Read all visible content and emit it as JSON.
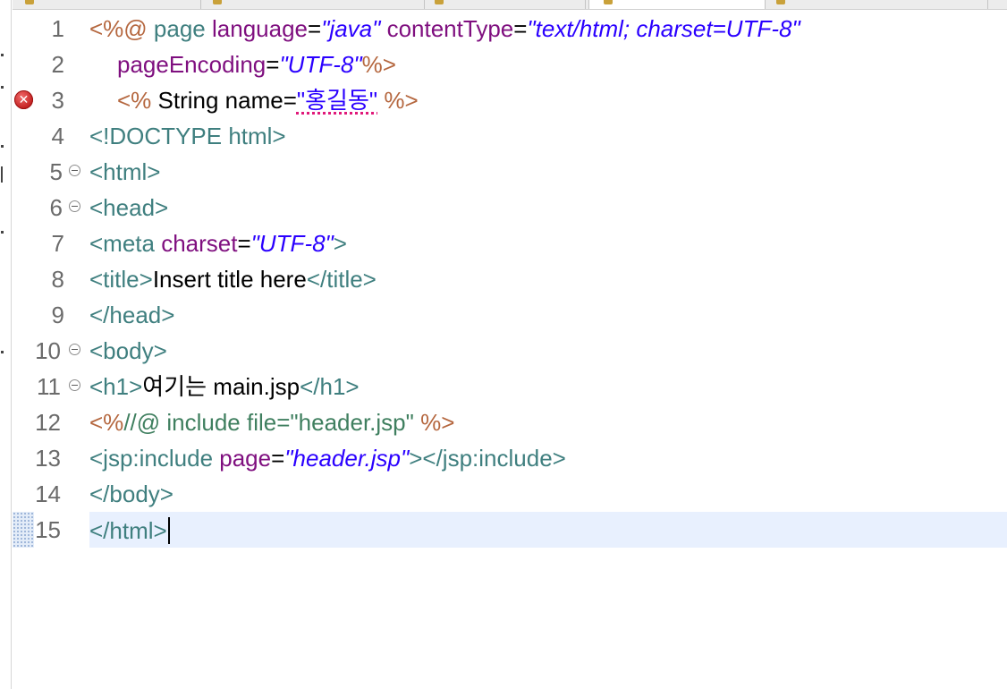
{
  "editor": {
    "lines": [
      {
        "number": "1",
        "tokens": [
          "<%@ ",
          "page ",
          "language",
          "=",
          "\"java\"",
          " ",
          "contentType",
          "=",
          "\"text/html; charset=UTF-8\""
        ]
      },
      {
        "number": "2",
        "tokens": [
          "pageEncoding",
          "=",
          "\"UTF-8\"",
          "%>"
        ]
      },
      {
        "number": "3",
        "tokens": [
          "<% ",
          "String name=",
          "\"홍길동\"",
          " %>"
        ]
      },
      {
        "number": "4",
        "tokens": [
          "<!DOCTYPE html>"
        ]
      },
      {
        "number": "5",
        "tokens": [
          "<html>"
        ]
      },
      {
        "number": "6",
        "tokens": [
          "<head>"
        ]
      },
      {
        "number": "7",
        "tokens": [
          "<meta ",
          "charset",
          "=",
          "\"UTF-8\"",
          ">"
        ]
      },
      {
        "number": "8",
        "tokens": [
          "<title>",
          "Insert title here",
          "</title>"
        ]
      },
      {
        "number": "9",
        "tokens": [
          "</head>"
        ]
      },
      {
        "number": "10",
        "tokens": [
          "<body>"
        ]
      },
      {
        "number": "11",
        "tokens": [
          "<h1>",
          "여기는 main.jsp",
          "</h1>"
        ]
      },
      {
        "number": "12",
        "tokens": [
          "<%",
          "//@ include file=\"header.jsp\" ",
          "%>"
        ]
      },
      {
        "number": "13",
        "tokens": [
          "<jsp:include ",
          "page",
          "=",
          "\"header.jsp\"",
          "></jsp:include>"
        ]
      },
      {
        "number": "14",
        "tokens": [
          "</body>"
        ]
      },
      {
        "number": "15",
        "tokens": [
          "</html>"
        ]
      }
    ],
    "error_line": "3",
    "current_line": "15",
    "foldable_lines": [
      "5",
      "6",
      "10",
      "11"
    ]
  },
  "colors": {
    "directive": "#b5673f",
    "tag": "#3f7f7f",
    "attribute": "#7f0f7f",
    "string": "#2a00ff",
    "comment": "#3f7f5f",
    "current_line_bg": "#e8f0fe",
    "error": "#c21f1f"
  },
  "icons": {
    "error": "error-icon",
    "fold": "fold-collapse-icon"
  }
}
